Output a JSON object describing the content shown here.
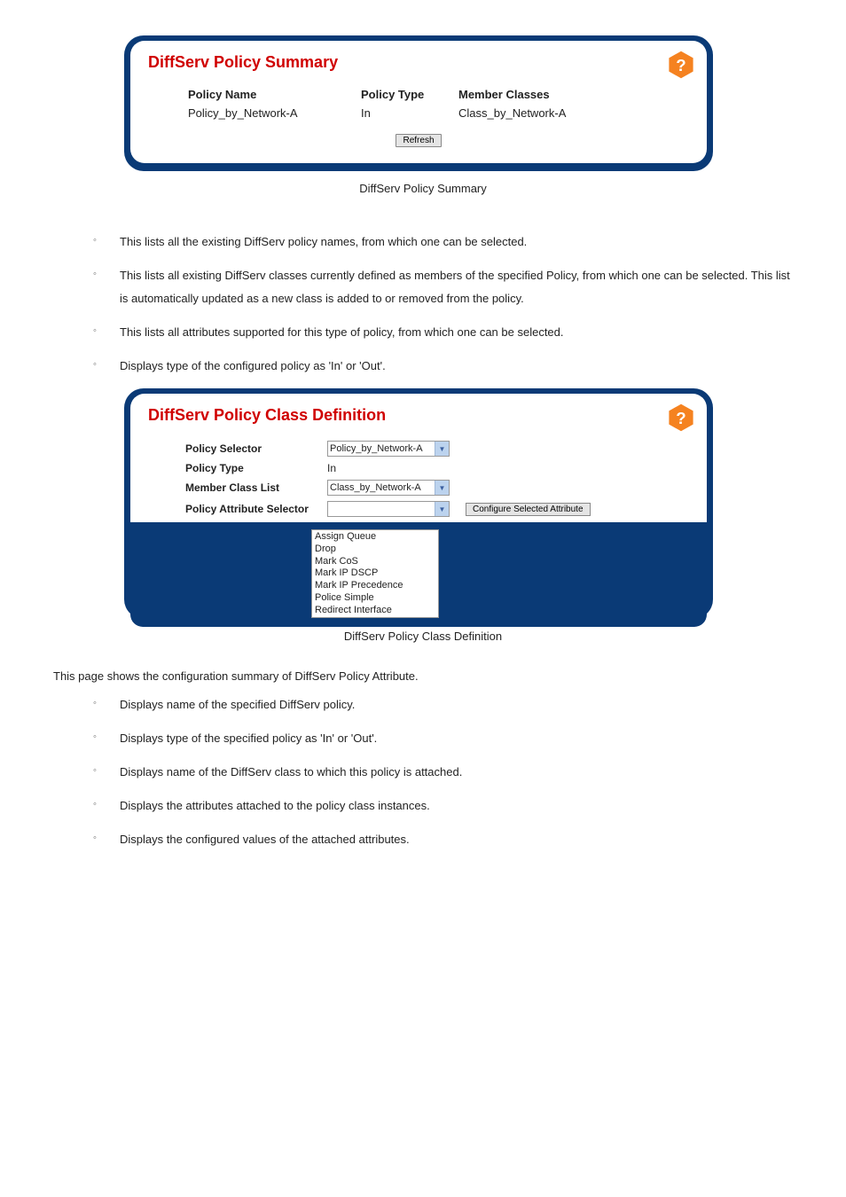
{
  "panel1": {
    "title": "DiffServ Policy Summary",
    "columns": [
      {
        "header": "Policy Name",
        "value": "Policy_by_Network-A"
      },
      {
        "header": "Policy Type",
        "value": "In"
      },
      {
        "header": "Member Classes",
        "value": "Class_by_Network-A"
      }
    ],
    "refresh": "Refresh",
    "caption": "DiffServ Policy Summary"
  },
  "bullets1": [
    "This lists all the existing DiffServ policy names, from which one can be selected.",
    "This lists all existing DiffServ classes currently defined as members of the specified Policy, from which one can be selected. This list is automatically updated as a new class is added to or removed from the policy.",
    "This lists all attributes supported for this type of policy, from which one can be selected.",
    "Displays type of the configured policy as 'In' or 'Out'."
  ],
  "panel2": {
    "title": "DiffServ Policy Class Definition",
    "rows": {
      "policy_selector_label": "Policy Selector",
      "policy_selector_value": "Policy_by_Network-A",
      "policy_type_label": "Policy Type",
      "policy_type_value": "In",
      "member_class_label": "Member Class List",
      "member_class_value": "Class_by_Network-A",
      "attr_selector_label": "Policy Attribute Selector",
      "attr_selector_value": "",
      "configure_btn": "Configure Selected Attribute"
    },
    "attr_options": [
      "Assign Queue",
      "Drop",
      "Mark CoS",
      "Mark IP DSCP",
      "Mark IP Precedence",
      "Police Simple",
      "Redirect Interface"
    ],
    "caption": "DiffServ Policy Class Definition"
  },
  "intro2": "This page shows the configuration summary of DiffServ Policy Attribute.",
  "bullets2": [
    "Displays name of the specified DiffServ policy.",
    "Displays type of the specified policy as 'In' or 'Out'.",
    "Displays name of the DiffServ class to which this policy is attached.",
    "Displays the attributes attached to the policy class instances.",
    "Displays the configured values of the attached attributes."
  ]
}
